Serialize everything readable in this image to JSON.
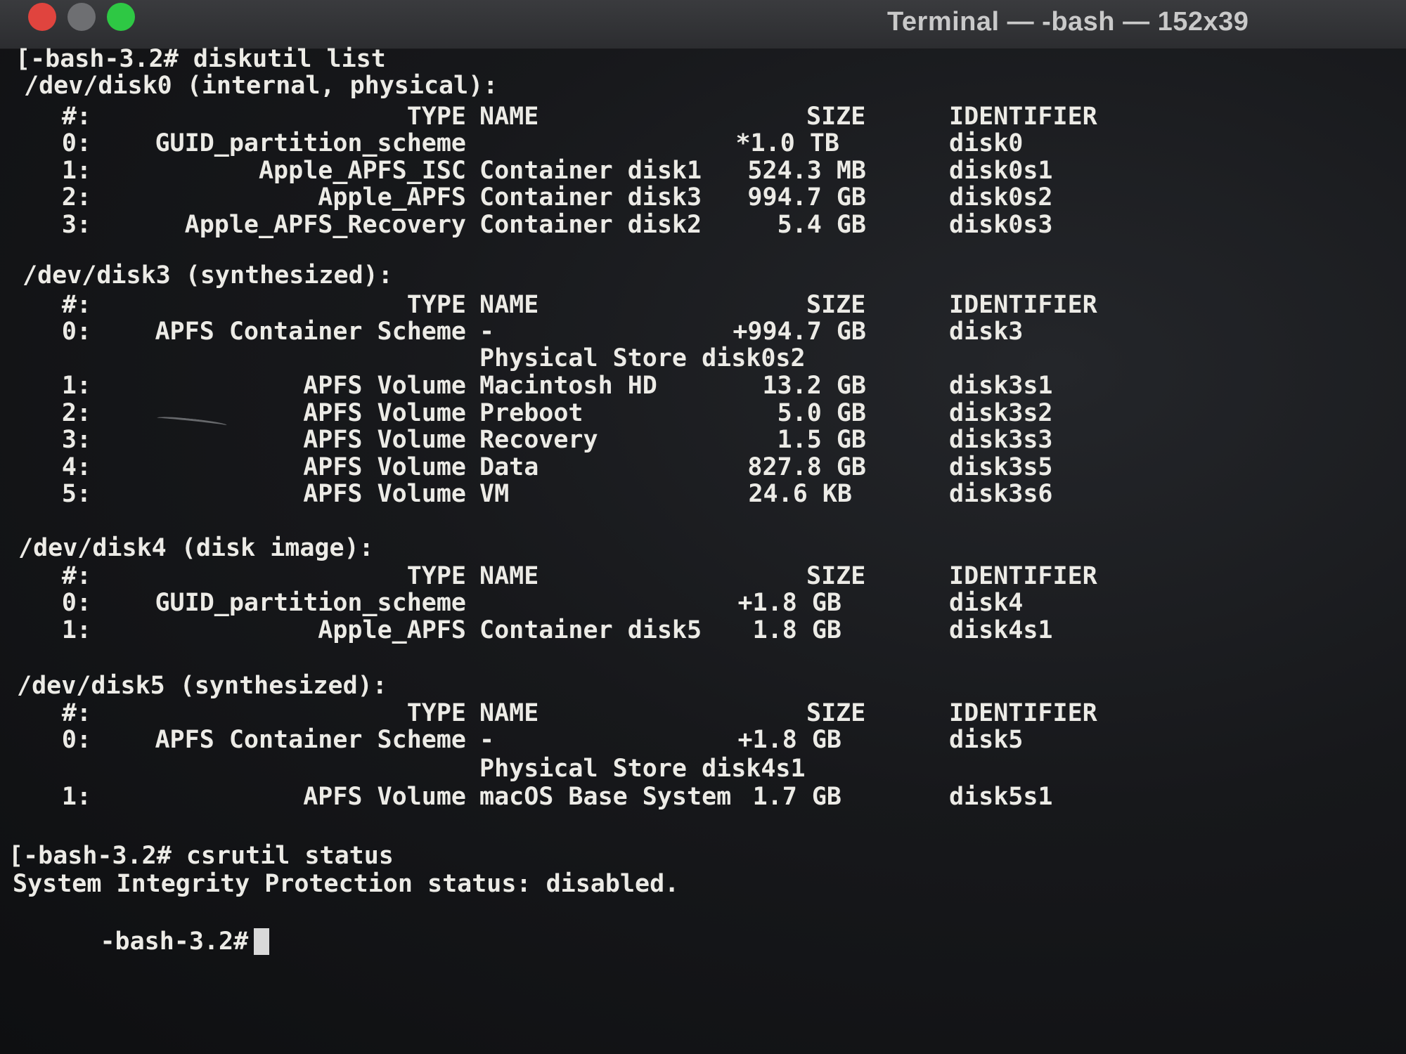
{
  "window": {
    "title": "Terminal — -bash — 152x39"
  },
  "terminal": {
    "cmd1": "[-bash-3.2# diskutil list",
    "disk0": {
      "header": "/dev/disk0 (internal, physical):",
      "cols": {
        "num": "#:",
        "type": "TYPE",
        "name": "NAME",
        "size": "SIZE",
        "id": "IDENTIFIER"
      },
      "rows": [
        {
          "num": "0:",
          "type": "GUID_partition_scheme",
          "name": "",
          "size": "*1.0 TB",
          "id": "disk0"
        },
        {
          "num": "1:",
          "type": "Apple_APFS_ISC",
          "name": "Container disk1",
          "size": "524.3 MB",
          "id": "disk0s1"
        },
        {
          "num": "2:",
          "type": "Apple_APFS",
          "name": "Container disk3",
          "size": "994.7 GB",
          "id": "disk0s2"
        },
        {
          "num": "3:",
          "type": "Apple_APFS_Recovery",
          "name": "Container disk2",
          "size": "5.4 GB",
          "id": "disk0s3"
        }
      ]
    },
    "disk3": {
      "header": "/dev/disk3 (synthesized):",
      "cols": {
        "num": "#:",
        "type": "TYPE",
        "name": "NAME",
        "size": "SIZE",
        "id": "IDENTIFIER"
      },
      "row0": {
        "num": "0:",
        "type": "APFS Container Scheme",
        "name": "-",
        "size": "+994.7 GB",
        "id": "disk3"
      },
      "store": "Physical Store disk0s2",
      "rows": [
        {
          "num": "1:",
          "type": "APFS Volume",
          "name": "Macintosh HD",
          "size": "13.2 GB",
          "id": "disk3s1"
        },
        {
          "num": "2:",
          "type": "APFS Volume",
          "name": "Preboot",
          "size": "5.0 GB",
          "id": "disk3s2"
        },
        {
          "num": "3:",
          "type": "APFS Volume",
          "name": "Recovery",
          "size": "1.5 GB",
          "id": "disk3s3"
        },
        {
          "num": "4:",
          "type": "APFS Volume",
          "name": "Data",
          "size": "827.8 GB",
          "id": "disk3s5"
        },
        {
          "num": "5:",
          "type": "APFS Volume",
          "name": "VM",
          "size": "24.6 KB",
          "id": "disk3s6"
        }
      ]
    },
    "disk4": {
      "header": "/dev/disk4 (disk image):",
      "cols": {
        "num": "#:",
        "type": "TYPE",
        "name": "NAME",
        "size": "SIZE",
        "id": "IDENTIFIER"
      },
      "rows": [
        {
          "num": "0:",
          "type": "GUID_partition_scheme",
          "name": "",
          "size": "+1.8 GB",
          "id": "disk4"
        },
        {
          "num": "1:",
          "type": "Apple_APFS",
          "name": "Container disk5",
          "size": "1.8 GB",
          "id": "disk4s1"
        }
      ]
    },
    "disk5": {
      "header": "/dev/disk5 (synthesized):",
      "cols": {
        "num": "#:",
        "type": "TYPE",
        "name": "NAME",
        "size": "SIZE",
        "id": "IDENTIFIER"
      },
      "row0": {
        "num": "0:",
        "type": "APFS Container Scheme",
        "name": "-",
        "size": "+1.8 GB",
        "id": "disk5"
      },
      "store": "Physical Store disk4s1",
      "rows": [
        {
          "num": "1:",
          "type": "APFS Volume",
          "name": "macOS Base System",
          "size": "1.7 GB",
          "id": "disk5s1"
        }
      ]
    },
    "cmd2": "[-bash-3.2# csrutil status",
    "csr_output": "System Integrity Protection status: disabled.",
    "prompt": "-bash-3.2#"
  }
}
